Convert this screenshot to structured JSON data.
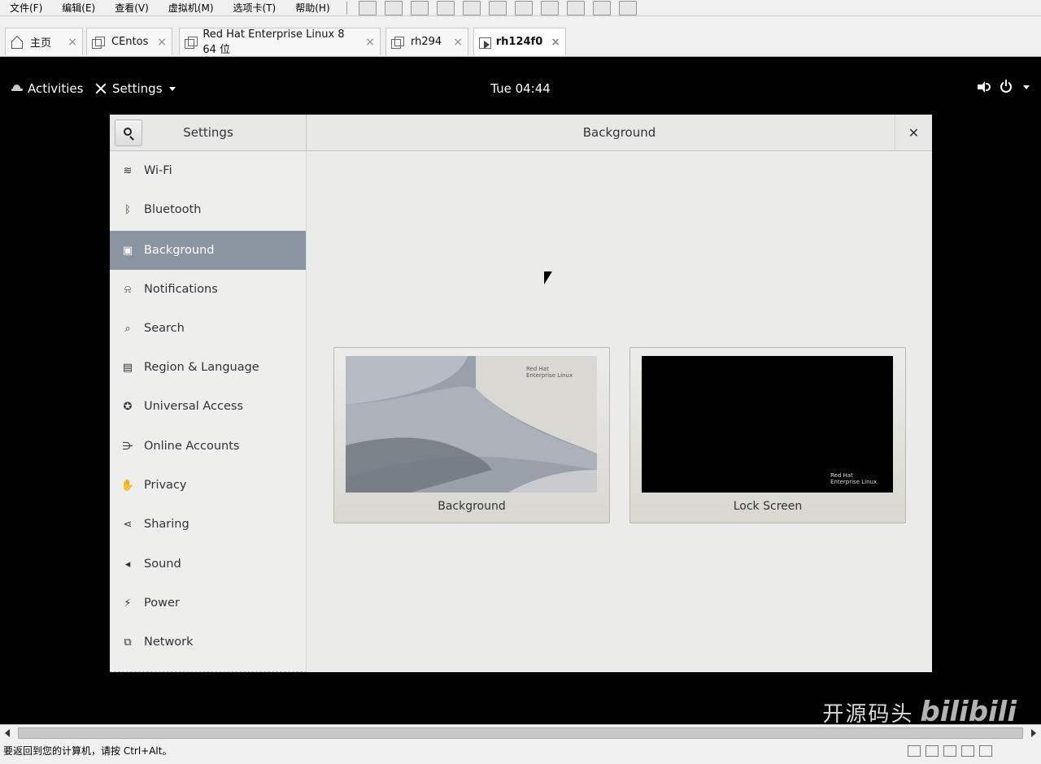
{
  "vm": {
    "menu": [
      "文件(F)",
      "编辑(E)",
      "查看(V)",
      "虚拟机(M)",
      "选项卡(T)",
      "帮助(H)"
    ],
    "tabs": [
      {
        "label": "主页",
        "icon": "home-icon"
      },
      {
        "label": "CEntos",
        "icon": "vm-icon"
      },
      {
        "label": "Red Hat Enterprise Linux 8 64 位",
        "icon": "vm-icon"
      },
      {
        "label": "rh294",
        "icon": "vm-icon"
      },
      {
        "label": "rh124f0",
        "icon": "vm-running-icon",
        "active": true
      }
    ],
    "tab_close": "×",
    "status_message": "要返回到您的计算机，请按 Ctrl+Alt。"
  },
  "gnome": {
    "activities": "Activities",
    "app_menu": "Settings",
    "clock": "Tue 04:44"
  },
  "settings": {
    "sidebar_title": "Settings",
    "panel_title": "Background",
    "close_glyph": "✕",
    "sidebar_items": [
      {
        "label": "Wi-Fi",
        "icon": "wifi-icon",
        "glyph": "≋"
      },
      {
        "label": "Bluetooth",
        "icon": "bluetooth-icon",
        "glyph": "ᛒ"
      },
      {
        "label": "Background",
        "icon": "background-icon",
        "glyph": "▣",
        "selected": true
      },
      {
        "label": "Notifications",
        "icon": "bell-icon",
        "glyph": "⍾"
      },
      {
        "label": "Search",
        "icon": "search-icon",
        "glyph": "⌕"
      },
      {
        "label": "Region & Language",
        "icon": "region-icon",
        "glyph": "▤"
      },
      {
        "label": "Universal Access",
        "icon": "accessibility-icon",
        "glyph": "✪"
      },
      {
        "label": "Online Accounts",
        "icon": "online-accounts-icon",
        "glyph": "⋺"
      },
      {
        "label": "Privacy",
        "icon": "privacy-hand-icon",
        "glyph": "✋"
      },
      {
        "label": "Sharing",
        "icon": "share-icon",
        "glyph": "⋖"
      },
      {
        "label": "Sound",
        "icon": "speaker-icon",
        "glyph": "◂"
      },
      {
        "label": "Power",
        "icon": "power-icon",
        "glyph": "⚡"
      },
      {
        "label": "Network",
        "icon": "network-icon",
        "glyph": "⧉"
      }
    ],
    "cards": [
      {
        "label": "Background",
        "logo_line1": "Red Hat",
        "logo_line2": "Enterprise Linux"
      },
      {
        "label": "Lock Screen",
        "logo_line1": "Red Hat",
        "logo_line2": "Enterprise Linux"
      }
    ]
  },
  "watermark": {
    "text": "开源码头",
    "logo": "bilibili"
  },
  "colors": {
    "selected_row": "#8b95a1",
    "sidebar_bg": "#eeeeec",
    "content_bg": "#ebebea"
  }
}
